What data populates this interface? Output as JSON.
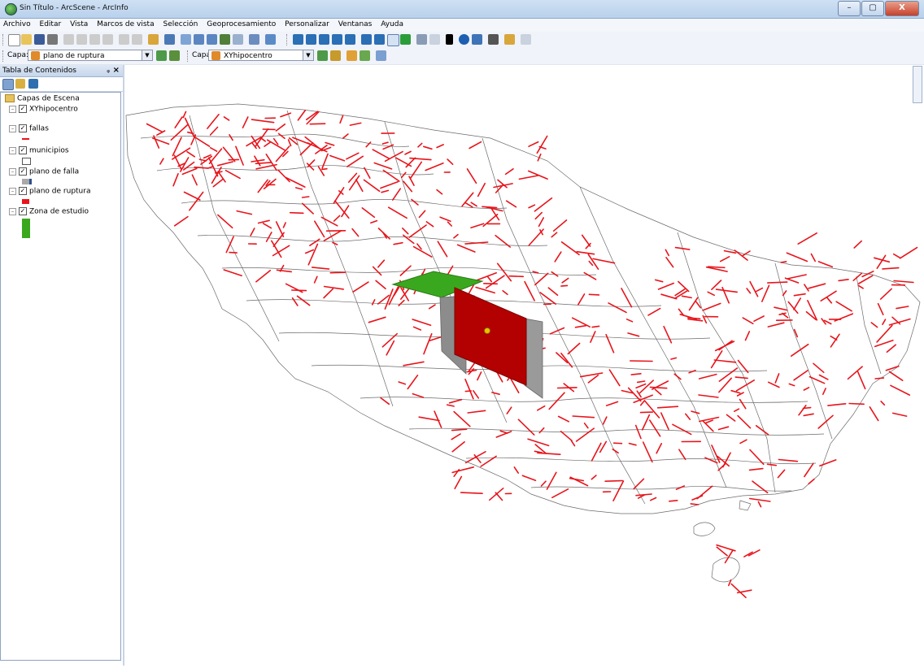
{
  "window": {
    "title": "Sin Título - ArcScene - ArcInfo",
    "controls": [
      "–",
      "▢",
      "X"
    ]
  },
  "menu": [
    "Archivo",
    "Editar",
    "Vista",
    "Marcos de vista",
    "Selección",
    "Geoprocesamiento",
    "Personalizar",
    "Ventanas",
    "Ayuda"
  ],
  "toolbar2": {
    "capa_label_1": "Capa:",
    "capa_value_1": "plano de ruptura",
    "capa_label_2": "Capa:",
    "capa_value_2": "XYhipocentro"
  },
  "toc": {
    "title": "Tabla de Contenidos",
    "pin": "ᵩ",
    "close": "×",
    "root": "Capas de Escena",
    "layers": [
      {
        "name": "XYhipocentro"
      },
      {
        "name": "fallas"
      },
      {
        "name": "municipios"
      },
      {
        "name": "plano de falla"
      },
      {
        "name": "plano de ruptura"
      },
      {
        "name": "Zona de estudio"
      }
    ]
  },
  "colors": {
    "fallas": "#e8141b",
    "municipios_outline": "#6b6b6b",
    "plano_falla": "#8c8c8c",
    "plano_ruptura": "#b30000",
    "zona_estudio": "#3aa81e",
    "hipocentro": "#e6c200"
  },
  "icons": [
    "app-globe-icon",
    "new-icon",
    "open-icon",
    "save-icon",
    "print-icon",
    "navigate-icon",
    "zoom-in-icon",
    "zoom-out-icon",
    "identify-icon",
    "layer-icon"
  ]
}
